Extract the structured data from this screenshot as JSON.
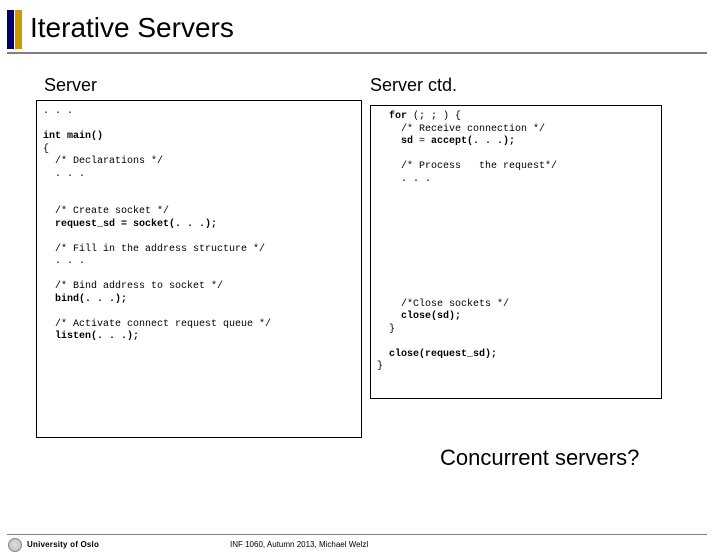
{
  "title": "Iterative Servers",
  "cols": {
    "left_head": "Server",
    "right_head": "Server ctd."
  },
  "code_left": ". . .\n\n<int main()|b>\n{\n  /* Declarations */\n  . . .\n\n\n  /* Create socket */\n  <request_sd = socket(. . .);|b>\n\n  /* Fill in the address structure */\n  . . .\n\n  /* Bind address to socket */\n  <bind(. . .);|b>\n\n  /* Activate connect request queue */\n  <listen(. . .);|b>",
  "code_right": "  <for|b> (; ; ) {\n    /* Receive connection */\n    <sd|b> = <accept(. . .);|b>\n\n    /* Process   the request*/\n    . . .\n\n\n\n\n\n\n\n\n\n    /*Close sockets */\n    <close(sd);|b>\n  }\n\n  <close(request_sd);|b>\n}",
  "concurrent": "Concurrent servers?",
  "footer": {
    "university": "University of Oslo",
    "course": "INF 1060, Autumn 2013, Michael Welzl"
  }
}
